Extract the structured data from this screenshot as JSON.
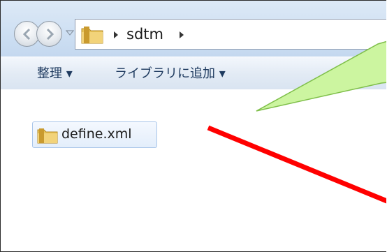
{
  "address_bar": {
    "crumbs": [
      "sdtm"
    ]
  },
  "command_bar": {
    "organize_label": "整理 ▾",
    "add_to_library_label": "ライブラリに追加 ▾"
  },
  "content": {
    "items": [
      {
        "name": "define.xml",
        "icon": "folder-icon"
      }
    ]
  },
  "colors": {
    "callout_fill": "#ccf5a0",
    "callout_stroke": "#7fbf4a",
    "annotation_line": "#ff0000",
    "toolbar_text": "#1e3a5f"
  }
}
